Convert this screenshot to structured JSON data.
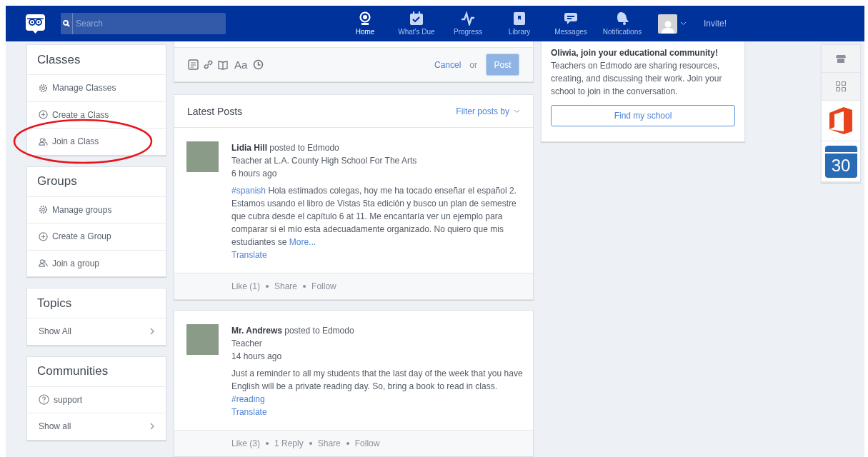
{
  "header": {
    "search": {
      "placeholder": "Search"
    },
    "nav": [
      {
        "kind": "home",
        "label": "Home",
        "selected": true
      },
      {
        "kind": "due",
        "label": "What's Due",
        "selected": false
      },
      {
        "kind": "progress",
        "label": "Progress",
        "selected": false
      },
      {
        "kind": "library",
        "label": "Library",
        "selected": false
      },
      {
        "kind": "messages",
        "label": "Messages",
        "selected": false
      },
      {
        "kind": "notifications",
        "label": "Notifications",
        "selected": false
      }
    ],
    "invite": "Invite!"
  },
  "sidebar": [
    {
      "title": "Classes",
      "items": [
        {
          "kind": "gear",
          "label": "Manage Classes",
          "circled": false
        },
        {
          "kind": "plus",
          "label": "Create a Class",
          "circled": false
        },
        {
          "kind": "people",
          "label": "Join a Class",
          "circled": true
        }
      ]
    },
    {
      "title": "Groups",
      "items": [
        {
          "kind": "gear",
          "label": "Manage groups",
          "circled": false
        },
        {
          "kind": "plus",
          "label": "Create a Group",
          "circled": false
        },
        {
          "kind": "people",
          "label": "Join a group",
          "circled": false
        }
      ]
    },
    {
      "title": "Topics",
      "items": [
        {
          "kind": "more",
          "label": "Show All",
          "circled": false
        }
      ]
    },
    {
      "title": "Communities",
      "items": [
        {
          "kind": "help",
          "label": "support",
          "circled": false
        },
        {
          "kind": "more",
          "label": "Show all",
          "circled": false
        }
      ]
    }
  ],
  "composer": {
    "font_tool": "Aa",
    "cancel": "Cancel",
    "or": "or",
    "post": {
      "label": "Post",
      "disabled": true
    }
  },
  "feed": {
    "title": "Latest Posts",
    "filter": "Filter posts by",
    "posts": [
      {
        "author": "**Lidia Hill** posted to Edmodo",
        "role": "Teacher at L.A. County High School For The Arts",
        "time": "6 hours ago",
        "lead_tag": "#spanish",
        "body": "Hola estimados colegas, hoy me ha tocado enseñar el español 2. Estamos usando el libro de Vistas 5ta edición y busco un plan de semestre que cubra desde el capítulo 6 at 11. Me encantaría ver un ejemplo para comparar si el mío esta adecuadamente organizado. No quiero que mis estudiantes se",
        "more": "More...",
        "translate": "Translate",
        "actions": [
          "Like (1)",
          "Share",
          "Follow"
        ]
      },
      {
        "author": "**Mr. Andrews** posted to Edmodo",
        "role": "Teacher",
        "time": "14 hours ago",
        "body": "Just a reminder to all my students that the last day of the week that you have English will be a private reading day. So, bring a book to read in class.",
        "trail_tag": "#reading",
        "translate": "Translate",
        "actions": [
          "Like (3)",
          "1 Reply",
          "Share",
          "Follow"
        ]
      }
    ]
  },
  "school_card": {
    "title": "Oliwia, join your educational community!",
    "text": "Teachers on Edmodo are sharing resources, creating, and discussing their work. Join your school to join in the conversation.",
    "button": "Find my school"
  },
  "rail": [
    {
      "kind": "store"
    },
    {
      "kind": "apps"
    },
    {
      "kind": "office"
    },
    {
      "kind": "calendar",
      "label": "30"
    }
  ]
}
